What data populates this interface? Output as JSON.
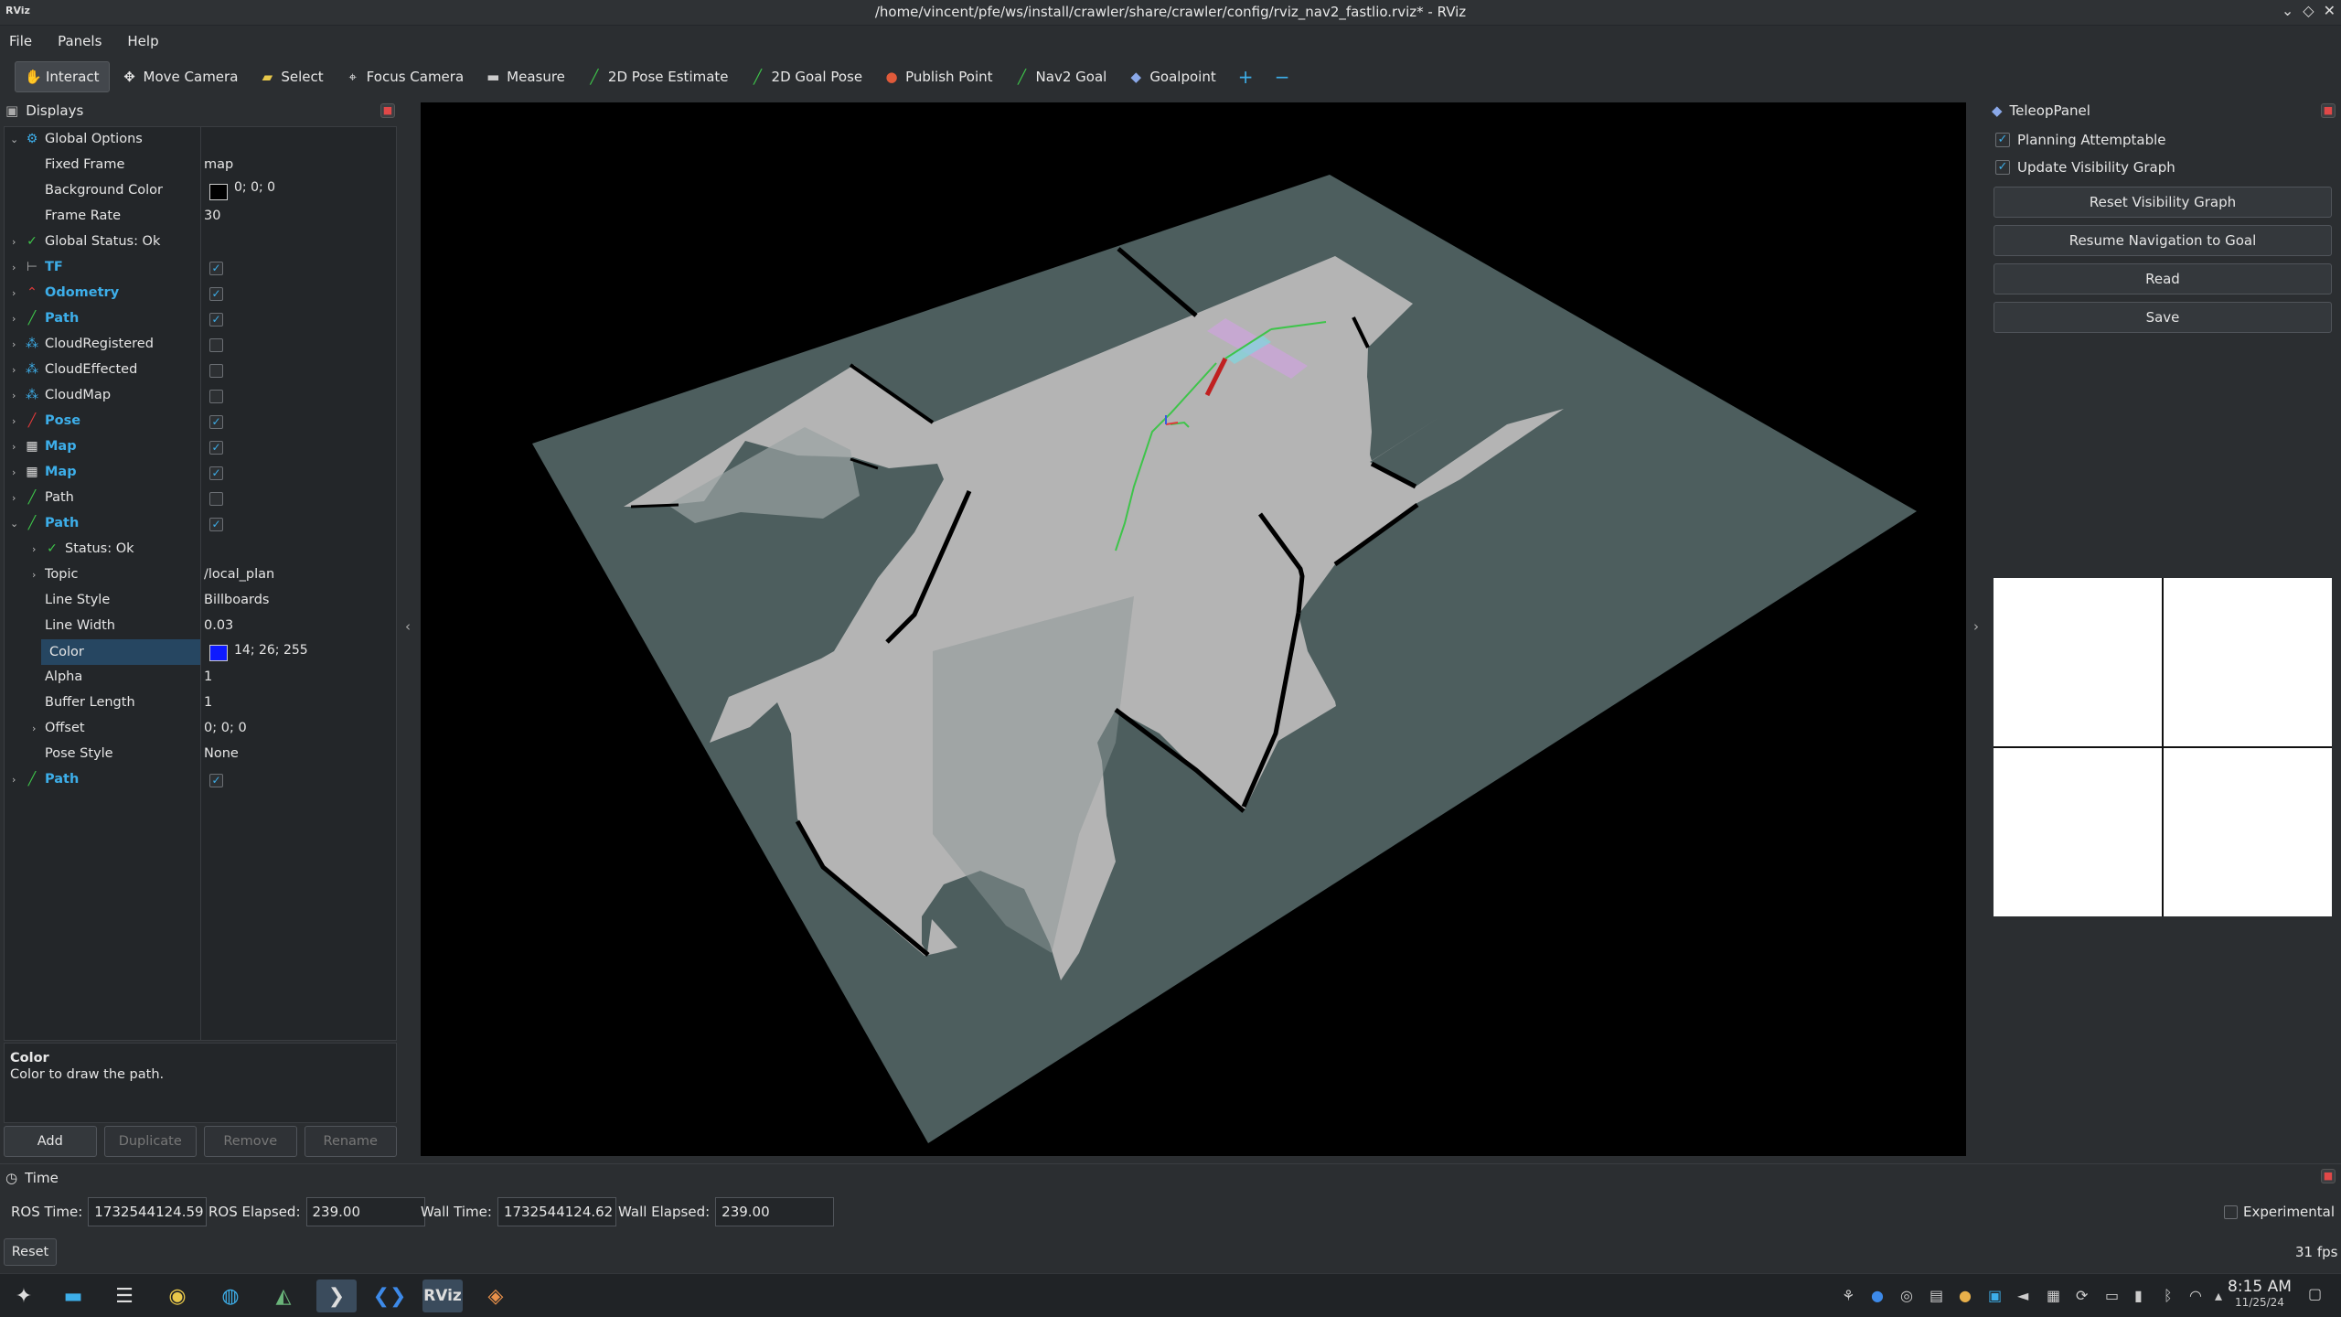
{
  "window": {
    "title": "/home/vincent/pfe/ws/install/crawler/share/crawler/config/rviz_nav2_fastlio.rviz* - RViz",
    "app_icon": "RViz"
  },
  "menu": [
    "File",
    "Panels",
    "Help"
  ],
  "toolbar": {
    "tools": [
      {
        "label": "Interact",
        "icon": "hand-icon"
      },
      {
        "label": "Move Camera",
        "icon": "move-icon"
      },
      {
        "label": "Select",
        "icon": "select-icon"
      },
      {
        "label": "Focus Camera",
        "icon": "focus-icon"
      },
      {
        "label": "Measure",
        "icon": "measure-icon"
      },
      {
        "label": "2D Pose Estimate",
        "icon": "arrow-green-icon"
      },
      {
        "label": "2D Goal Pose",
        "icon": "arrow-green-icon"
      },
      {
        "label": "Publish Point",
        "icon": "pin-icon"
      },
      {
        "label": "Nav2 Goal",
        "icon": "arrow-green-icon"
      },
      {
        "label": "Goalpoint",
        "icon": "diamond-icon"
      }
    ],
    "plus": "+",
    "minus": "−"
  },
  "displays": {
    "title": "Displays",
    "rows": [
      {
        "label": "Global Options",
        "value": ""
      },
      {
        "label": "Fixed Frame",
        "value": "map"
      },
      {
        "label": "Background Color",
        "value": "0; 0; 0"
      },
      {
        "label": "Frame Rate",
        "value": "30"
      },
      {
        "label": "Global Status: Ok",
        "value": ""
      },
      {
        "label": "TF",
        "value": ""
      },
      {
        "label": "Odometry",
        "value": ""
      },
      {
        "label": "Path",
        "value": ""
      },
      {
        "label": "CloudRegistered",
        "value": ""
      },
      {
        "label": "CloudEffected",
        "value": ""
      },
      {
        "label": "CloudMap",
        "value": ""
      },
      {
        "label": "Pose",
        "value": ""
      },
      {
        "label": "Map",
        "value": ""
      },
      {
        "label": "Map",
        "value": ""
      },
      {
        "label": "Path",
        "value": ""
      },
      {
        "label": "Path",
        "value": ""
      },
      {
        "label": "Status: Ok",
        "value": ""
      },
      {
        "label": "Topic",
        "value": "/local_plan"
      },
      {
        "label": "Line Style",
        "value": "Billboards"
      },
      {
        "label": "Line Width",
        "value": "0.03"
      },
      {
        "label": "Color",
        "value": "14; 26; 255"
      },
      {
        "label": "Alpha",
        "value": "1"
      },
      {
        "label": "Buffer Length",
        "value": "1"
      },
      {
        "label": "Offset",
        "value": "0; 0; 0"
      },
      {
        "label": "Pose Style",
        "value": "None"
      },
      {
        "label": "Path",
        "value": ""
      }
    ],
    "desc_title": "Color",
    "desc_text": "Color to draw the path.",
    "buttons": [
      "Add",
      "Duplicate",
      "Remove",
      "Rename"
    ]
  },
  "teleop": {
    "title": "TeleopPanel",
    "checks": [
      "Planning Attemptable",
      "Update Visibility Graph"
    ],
    "buttons": [
      "Reset Visibility Graph",
      "Resume Navigation to Goal",
      "Read",
      "Save"
    ]
  },
  "time": {
    "title": "Time",
    "ros_time_label": "ROS Time:",
    "ros_time": "1732544124.59",
    "ros_elapsed_label": "ROS Elapsed:",
    "ros_elapsed": "239.00",
    "wall_time_label": "Wall Time:",
    "wall_time": "1732544124.62",
    "wall_elapsed_label": "Wall Elapsed:",
    "wall_elapsed": "239.00",
    "experimental": "Experimental",
    "reset": "Reset",
    "fps": "31 fps"
  },
  "taskbar": {
    "clock_time": "8:15 AM",
    "clock_date": "11/25/24"
  },
  "colors": {
    "accent": "#3daee9",
    "path_color": "#0e1aff",
    "map_unknown": "#4d5e5e",
    "map_free": "#b4b4b4"
  }
}
